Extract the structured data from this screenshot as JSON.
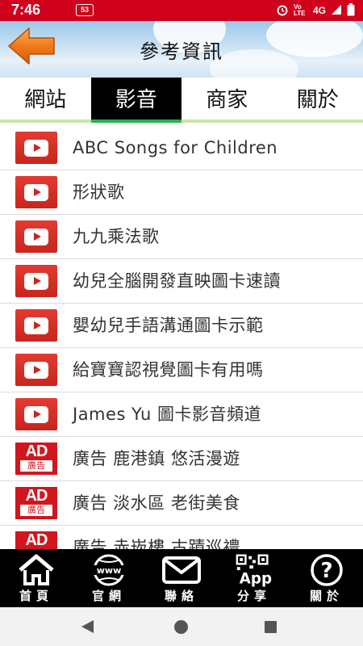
{
  "status_bar": {
    "time": "7:46",
    "badge": "53",
    "network": "4G",
    "volte": "Vo LTE"
  },
  "header": {
    "title": "參考資訊",
    "back_icon": "arrow-left-icon"
  },
  "tabs": [
    {
      "label": "網站",
      "active": false
    },
    {
      "label": "影音",
      "active": true
    },
    {
      "label": "商家",
      "active": false
    },
    {
      "label": "關於",
      "active": false
    }
  ],
  "list": [
    {
      "icon": "youtube-icon",
      "label": "ABC Songs for Children"
    },
    {
      "icon": "youtube-icon",
      "label": "形狀歌"
    },
    {
      "icon": "youtube-icon",
      "label": "九九乘法歌"
    },
    {
      "icon": "youtube-icon",
      "label": "幼兒全腦開發直映圖卡速讀"
    },
    {
      "icon": "youtube-icon",
      "label": "嬰幼兒手語溝通圖卡示範"
    },
    {
      "icon": "youtube-icon",
      "label": "給寶寶認視覺圖卡有用嗎"
    },
    {
      "icon": "youtube-icon",
      "label": "James Yu 圖卡影音頻道"
    },
    {
      "icon": "ad-icon",
      "label": "廣告 鹿港鎮 悠活漫遊"
    },
    {
      "icon": "ad-icon",
      "label": "廣告 淡水區 老街美食"
    },
    {
      "icon": "ad-icon",
      "label": "廣告 赤崁樓 古蹟巡禮"
    }
  ],
  "ad_badge": {
    "big": "AD",
    "small": "廣告"
  },
  "bottom_nav": [
    {
      "label": "首頁",
      "icon": "home-icon"
    },
    {
      "label": "官網",
      "icon": "www-globe-icon"
    },
    {
      "label": "聯絡",
      "icon": "mail-icon"
    },
    {
      "label": "分享",
      "icon": "qr-app-icon",
      "icon_text": "App"
    },
    {
      "label": "關於",
      "icon": "question-icon"
    }
  ],
  "colors": {
    "status_bar": "#d0021b",
    "tab_active_bg": "#000000",
    "tab_underline": "#2bb24c",
    "youtube_red": "#c8251d",
    "ad_red": "#d2161e",
    "back_arrow": "#f07a1a"
  }
}
